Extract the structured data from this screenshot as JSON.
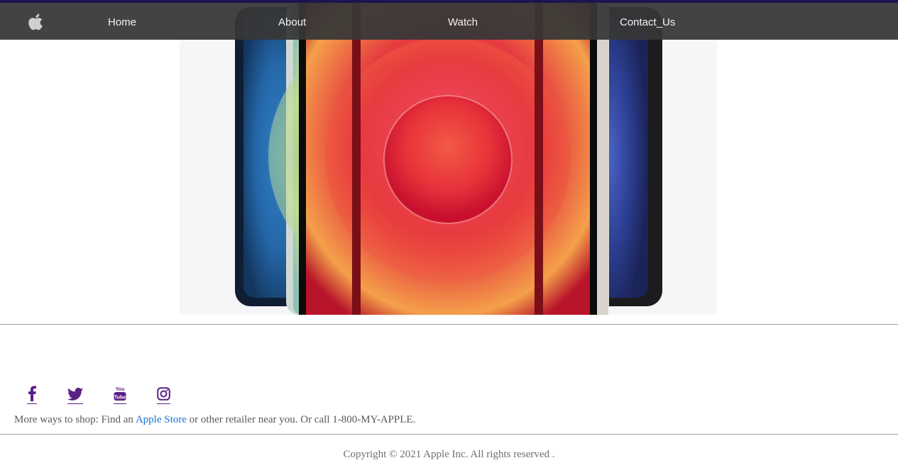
{
  "nav": {
    "logo": "apple-logo-icon",
    "links": [
      {
        "label": "Home"
      },
      {
        "label": "About"
      },
      {
        "label": "Watch"
      },
      {
        "label": "Contact_Us"
      }
    ]
  },
  "hero": {
    "image": "iphone-12-lineup-image",
    "colors": {
      "blue": "#1f5d99",
      "green": "#b7d98a",
      "red": "#e8293a",
      "white": "#ebe6dc",
      "black": "#1a1a1a",
      "background": "#f6f6f8"
    }
  },
  "social": {
    "icons": [
      "facebook-icon",
      "twitter-icon",
      "youtube-icon",
      "instagram-icon"
    ],
    "color": "#5b1f86"
  },
  "footer": {
    "shop_prefix": "More ways to shop: Find an ",
    "shop_link": "Apple Store",
    "shop_suffix": " or other retailer near you. Or call 1-800-MY-APPLE.",
    "copyright": "Copyright © 2021 Apple Inc. All rights reserved ."
  }
}
